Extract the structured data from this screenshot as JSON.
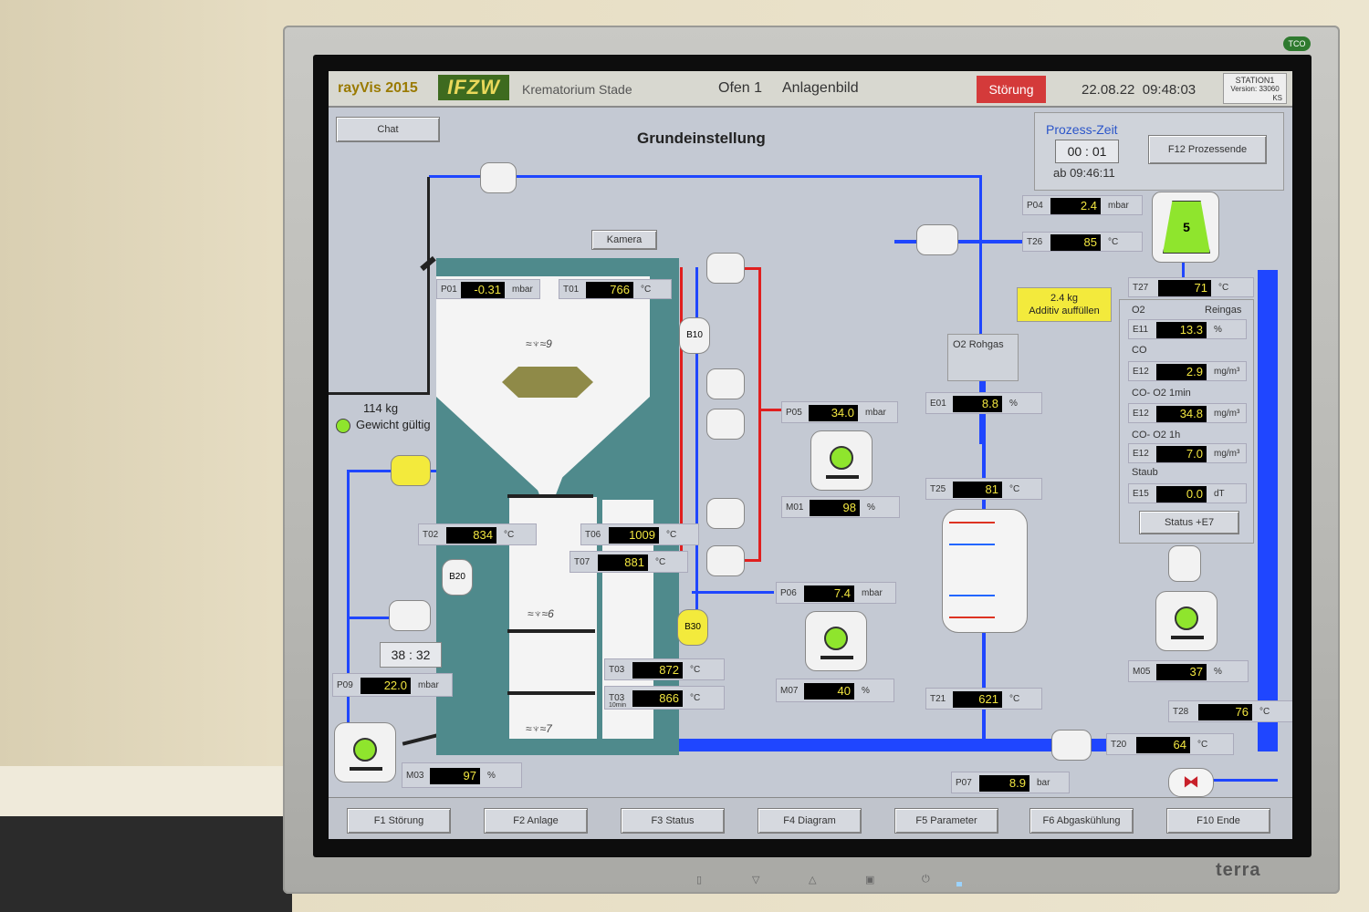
{
  "app": {
    "name": "rayVis 2015",
    "logo_text": "IFZW",
    "site": "Krematorium Stade",
    "oven": "Ofen 1",
    "view": "Anlagenbild",
    "alarm": "Störung",
    "date": "22.08.22",
    "time": "09:48:03",
    "station": "STATION1",
    "version": "Version: 33060",
    "station_code": "KS"
  },
  "buttons": {
    "chat": "Chat",
    "kamera": "Kamera",
    "prozessende": "F12   Prozessende",
    "status_e7": "Status +E7"
  },
  "heading": "Grundeinstellung",
  "process": {
    "label": "Prozess-Zeit",
    "elapsed": "00 : 01",
    "since": "ab 09:46:11"
  },
  "additive": {
    "amount": "2.4   kg",
    "text": "Additiv auffüllen"
  },
  "weight": {
    "value": "114  kg",
    "status": "Gewicht gültig"
  },
  "timer": "38 : 32",
  "gas_labels": {
    "rohgas": "O2    Rohgas",
    "o2": "O2",
    "reingas": "Reingas",
    "co": "CO",
    "co_o2_1min": "CO- O2 1min",
    "co_o2_1h": "CO- O2 1h",
    "staub": "Staub"
  },
  "devices": {
    "b10": "B10",
    "b20": "B20",
    "b30": "B30",
    "cyclone": "5"
  },
  "readings": {
    "P01": {
      "tag": "P01",
      "value": "-0.31",
      "unit": "mbar"
    },
    "T01": {
      "tag": "T01",
      "value": "766",
      "unit": "°C"
    },
    "T02": {
      "tag": "T02",
      "value": "834",
      "unit": "°C"
    },
    "T06": {
      "tag": "T06",
      "value": "1009",
      "unit": "°C"
    },
    "T07": {
      "tag": "T07",
      "value": "881",
      "unit": "°C"
    },
    "T03": {
      "tag": "T03",
      "value": "872",
      "unit": "°C"
    },
    "T03b": {
      "tag": "T03",
      "sub": "10min",
      "value": "866",
      "unit": "°C"
    },
    "P09": {
      "tag": "P09",
      "value": "22.0",
      "unit": "mbar"
    },
    "M03": {
      "tag": "M03",
      "value": "97",
      "unit": "%"
    },
    "P05": {
      "tag": "P05",
      "value": "34.0",
      "unit": "mbar"
    },
    "M01": {
      "tag": "M01",
      "value": "98",
      "unit": "%"
    },
    "P06": {
      "tag": "P06",
      "value": "7.4",
      "unit": "mbar"
    },
    "M07": {
      "tag": "M07",
      "value": "40",
      "unit": "%"
    },
    "E01": {
      "tag": "E01",
      "value": "8.8",
      "unit": "%"
    },
    "T25": {
      "tag": "T25",
      "value": "81",
      "unit": "°C"
    },
    "T21": {
      "tag": "T21",
      "value": "621",
      "unit": "°C"
    },
    "P04": {
      "tag": "P04",
      "value": "2.4",
      "unit": "mbar"
    },
    "T26": {
      "tag": "T26",
      "value": "85",
      "unit": "°C"
    },
    "T27": {
      "tag": "T27",
      "value": "71",
      "unit": "°C"
    },
    "E11": {
      "tag": "E11",
      "value": "13.3",
      "unit": "%"
    },
    "E12a": {
      "tag": "E12",
      "value": "2.9",
      "unit": "mg/m³"
    },
    "E12b": {
      "tag": "E12",
      "value": "34.8",
      "unit": "mg/m³"
    },
    "E12c": {
      "tag": "E12",
      "value": "7.0",
      "unit": "mg/m³"
    },
    "E15": {
      "tag": "E15",
      "value": "0.0",
      "unit": "dT"
    },
    "M05": {
      "tag": "M05",
      "value": "37",
      "unit": "%"
    },
    "T28": {
      "tag": "T28",
      "value": "76",
      "unit": "°C"
    },
    "T20": {
      "tag": "T20",
      "value": "64",
      "unit": "°C"
    },
    "P07": {
      "tag": "P07",
      "value": "8.9",
      "unit": "bar"
    }
  },
  "footer": [
    "F1 Störung",
    "F2 Anlage",
    "F3 Status",
    "F4 Diagram",
    "F5 Parameter",
    "F6 Abgaskühlung",
    "F10 Ende"
  ],
  "monitor": {
    "brand": "terra",
    "badge": "TCO"
  },
  "colors": {
    "pipe_blue": "#1f46ff",
    "pipe_red": "#e01f1f",
    "furnace": "#4f8a8c",
    "fan_green": "#8fe52d",
    "value_text": "#f2e640",
    "alarm": "#d43a3a",
    "additive_bg": "#f3ea3c"
  }
}
